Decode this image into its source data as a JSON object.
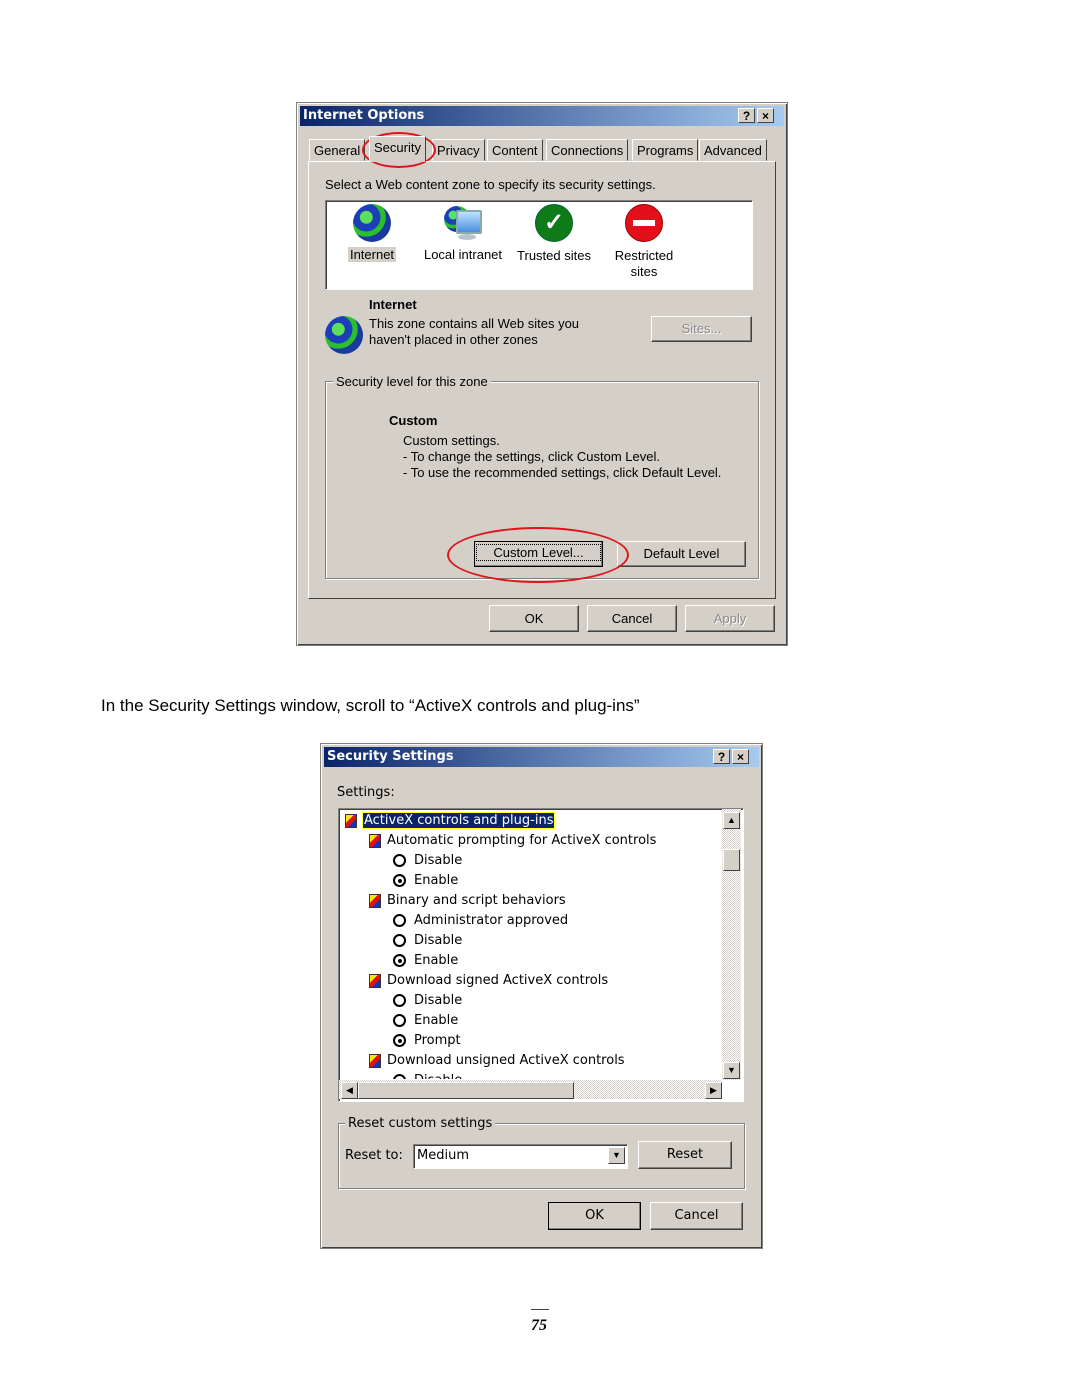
{
  "internet_options": {
    "title": "Internet Options",
    "help_button": "?",
    "close_button": "×",
    "tabs": [
      {
        "label": "General",
        "active": false
      },
      {
        "label": "Security",
        "active": true
      },
      {
        "label": "Privacy",
        "active": false
      },
      {
        "label": "Content",
        "active": false
      },
      {
        "label": "Connections",
        "active": false
      },
      {
        "label": "Programs",
        "active": false
      },
      {
        "label": "Advanced",
        "active": false
      }
    ],
    "instruction": "Select a Web content zone to specify its security settings.",
    "zones": [
      {
        "label": "Internet",
        "icon": "globe-icon",
        "selected": true
      },
      {
        "label": "Local intranet",
        "icon": "intranet-icon",
        "selected": false
      },
      {
        "label": "Trusted sites",
        "icon": "checkmark-icon",
        "selected": false
      },
      {
        "label": "Restricted sites",
        "icon": "no-entry-icon",
        "selected": false
      }
    ],
    "zone_info": {
      "title": "Internet",
      "line1": "This zone contains all Web sites you",
      "line2": "haven't placed in other zones",
      "sites_button": "Sites..."
    },
    "security_level": {
      "legend": "Security level for this zone",
      "level_name": "Custom",
      "desc1": "Custom settings.",
      "desc2": "- To change the settings, click Custom Level.",
      "desc3": "- To use the recommended settings, click Default Level.",
      "custom_level_button": "Custom Level...",
      "default_level_button": "Default Level"
    },
    "buttons": {
      "ok": "OK",
      "cancel": "Cancel",
      "apply": "Apply"
    },
    "highlight_color": "#e0141c"
  },
  "caption": "In the Security Settings window, scroll to “ActiveX controls and plug-ins”",
  "security_settings": {
    "title": "Security Settings",
    "help_button": "?",
    "close_button": "×",
    "settings_label": "Settings:",
    "tree": [
      {
        "type": "category",
        "label": "ActiveX controls and plug-ins",
        "selected": true
      },
      {
        "type": "setting",
        "label": "Automatic prompting for ActiveX controls"
      },
      {
        "type": "option",
        "label": "Disable",
        "checked": false
      },
      {
        "type": "option",
        "label": "Enable",
        "checked": true
      },
      {
        "type": "setting",
        "label": "Binary and script behaviors"
      },
      {
        "type": "option",
        "label": "Administrator approved",
        "checked": false
      },
      {
        "type": "option",
        "label": "Disable",
        "checked": false
      },
      {
        "type": "option",
        "label": "Enable",
        "checked": true
      },
      {
        "type": "setting",
        "label": "Download signed ActiveX controls"
      },
      {
        "type": "option",
        "label": "Disable",
        "checked": false
      },
      {
        "type": "option",
        "label": "Enable",
        "checked": false
      },
      {
        "type": "option",
        "label": "Prompt",
        "checked": true
      },
      {
        "type": "setting",
        "label": "Download unsigned ActiveX controls"
      },
      {
        "type": "option",
        "label": "Disable",
        "checked": false
      }
    ],
    "reset_group": {
      "legend": "Reset custom settings",
      "reset_to_label": "Reset to:",
      "reset_to_value": "Medium",
      "reset_button": "Reset"
    },
    "buttons": {
      "ok": "OK",
      "cancel": "Cancel"
    }
  },
  "page_number": "75"
}
